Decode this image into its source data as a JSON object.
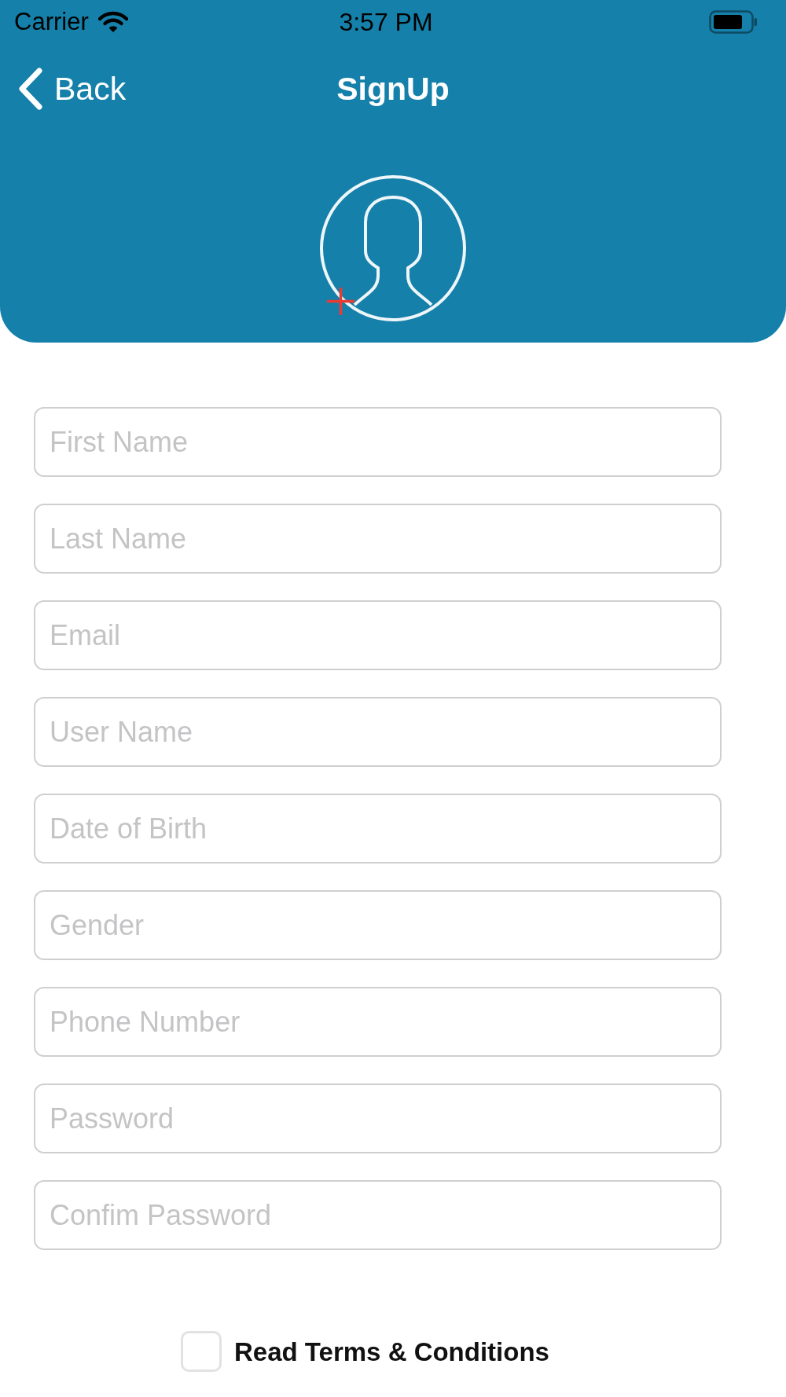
{
  "status_bar": {
    "carrier": "Carrier",
    "time": "3:57 PM"
  },
  "nav_bar": {
    "back": "Back",
    "title": "SignUp"
  },
  "fields": [
    {
      "placeholder": "First Name"
    },
    {
      "placeholder": "Last Name"
    },
    {
      "placeholder": "Email"
    },
    {
      "placeholder": "User Name"
    },
    {
      "placeholder": "Date of Birth"
    },
    {
      "placeholder": "Gender"
    },
    {
      "placeholder": "Phone Number"
    },
    {
      "placeholder": "Password"
    },
    {
      "placeholder": "Confim Password"
    }
  ],
  "terms": {
    "label": "Read Terms & Conditions",
    "checked": false
  }
}
